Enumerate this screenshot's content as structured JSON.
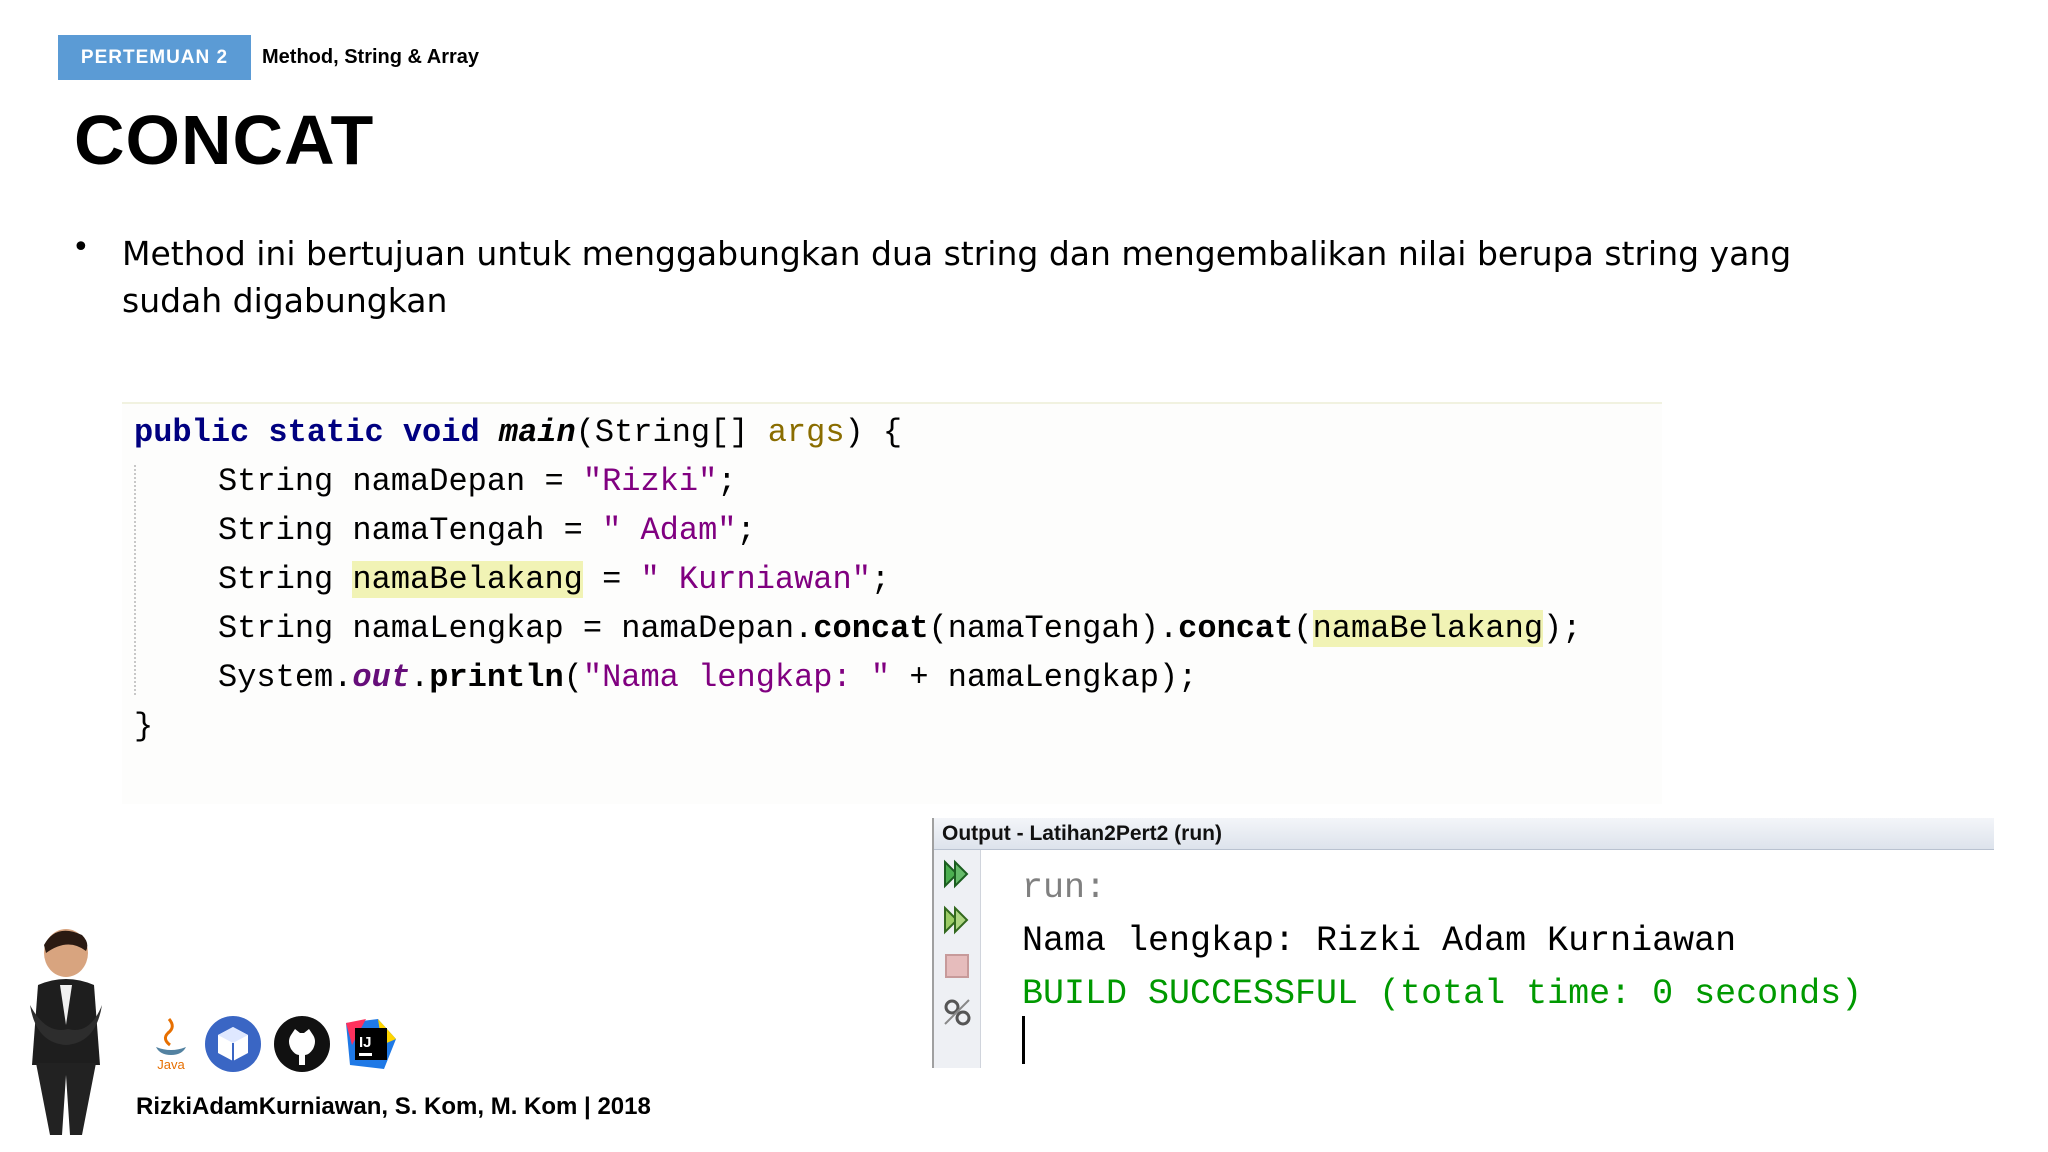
{
  "header": {
    "badge": "PERTEMUAN 2",
    "subtitle": "Method, String & Array",
    "title": "CONCAT"
  },
  "bullet": {
    "text": "Method ini bertujuan untuk menggabungkan dua string dan mengembalikan nilai berupa string yang sudah digabungkan"
  },
  "code": {
    "l1_kw": "public static void ",
    "l1_method": "main",
    "l1_paren": "(String[] ",
    "l1_param": "args",
    "l1_end": ") {",
    "l2_a": "String namaDepan = ",
    "l2_str": "\"Rizki\"",
    "l2_end": ";",
    "l3_a": "String namaTengah = ",
    "l3_str": "\" Adam\"",
    "l3_end": ";",
    "l4_a": "String ",
    "l4_var": "namaBelakang",
    "l4_b": " = ",
    "l4_str": "\" Kurniawan\"",
    "l4_end": ";",
    "l5_a": "String namaLengkap = namaDepan.",
    "l5_m1": "concat",
    "l5_b": "(namaTengah).",
    "l5_m2": "concat",
    "l5_c": "(",
    "l5_var": "namaBelakang",
    "l5_end": ");",
    "l6_a": "System.",
    "l6_field": "out",
    "l6_dot": ".",
    "l6_m": "println",
    "l6_b": "(",
    "l6_str": "\"Nama lengkap: \"",
    "l6_end": " + namaLengkap);",
    "l7": "}"
  },
  "output": {
    "title": "Output - Latihan2Pert2 (run)",
    "line1": "run:",
    "line2": "Nama lengkap: Rizki Adam Kurniawan",
    "line3": "BUILD SUCCESSFUL (total time: 0 seconds)",
    "icons": [
      "rerun-icon",
      "rerun-with-args-icon",
      "stop-icon",
      "settings-icon"
    ],
    "colors": {
      "run": "#808080",
      "normal": "#000000",
      "success": "#009900"
    }
  },
  "footer": {
    "author": "RizkiAdamKurniawan, S. Kom, M. Kom | 2018",
    "logos": [
      "java-logo",
      "app-cube-logo",
      "github-logo",
      "intellij-logo"
    ],
    "logo_java_label": "Java",
    "logo_ij_label": "IJ"
  },
  "colors": {
    "badge": "#5b9bd5",
    "keyword": "#000080",
    "string": "#008000",
    "highlight": "#f1f3b5"
  }
}
